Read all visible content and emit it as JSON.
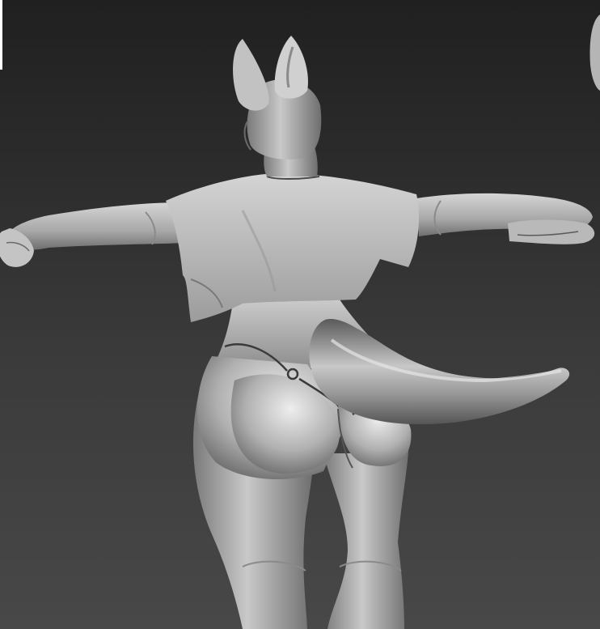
{
  "viewport": {
    "background_top": "#202020",
    "background_bottom": "#484848"
  },
  "model": {
    "material": "gray clay",
    "base_color": "#b8b8b8",
    "shadow_color": "#4a4a4a",
    "highlight_color": "#efefef",
    "view": "back",
    "pose": "T-pose",
    "parts": [
      "ears",
      "head",
      "neck",
      "crop-shirt",
      "arms",
      "hands",
      "torso",
      "thong",
      "hips",
      "tail",
      "legs"
    ]
  }
}
